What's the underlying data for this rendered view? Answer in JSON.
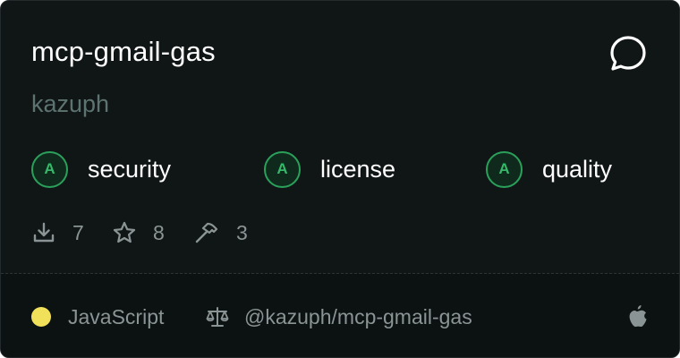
{
  "title": "mcp-gmail-gas",
  "author": "kazuph",
  "badges": [
    {
      "grade": "A",
      "label": "security"
    },
    {
      "grade": "A",
      "label": "license"
    },
    {
      "grade": "A",
      "label": "quality"
    }
  ],
  "stats": {
    "downloads": "7",
    "stars": "8",
    "tools": "3"
  },
  "footer": {
    "language": "JavaScript",
    "language_color": "#f1e05a",
    "repo": "@kazuph/mcp-gmail-gas"
  },
  "icons": {
    "chat": "chat-bubble-icon",
    "download": "download-icon",
    "star": "star-icon",
    "tools": "hammer-icon",
    "license": "scale-icon",
    "platform": "apple-icon"
  },
  "colors": {
    "background": "#101516",
    "grade_accent": "#2aa05b"
  }
}
